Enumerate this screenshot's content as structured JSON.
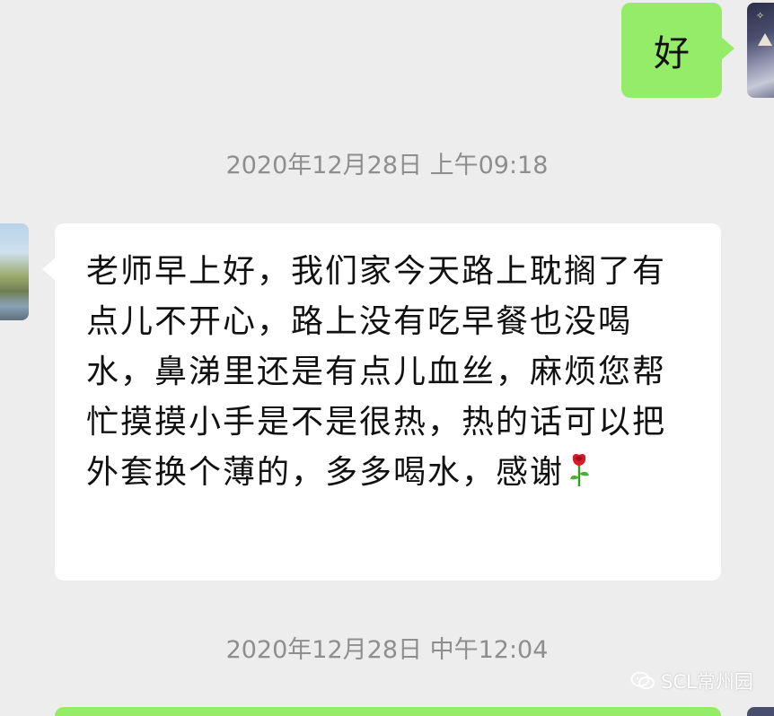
{
  "conversation": {
    "outgoing_top": {
      "text": "好"
    },
    "timestamps": [
      "2020年12月28日 上午09:18",
      "2020年12月28日 中午12:04"
    ],
    "incoming": {
      "text": "老师早上好，我们家今天路上耽搁了有点儿不开心，路上没有吃早餐也没喝水，鼻涕里还是有点儿血丝，麻烦您帮忙摸摸小手是不是很热，热的话可以把外套换个薄的，多多喝水，感谢",
      "emoji": "rose-icon"
    }
  },
  "watermark": {
    "text": "SCL常州园",
    "icon": "wechat-icon"
  },
  "colors": {
    "background": "#ededed",
    "outgoing_bubble": "#95ec69",
    "incoming_bubble": "#ffffff",
    "timestamp_text": "#8e8e8e"
  }
}
